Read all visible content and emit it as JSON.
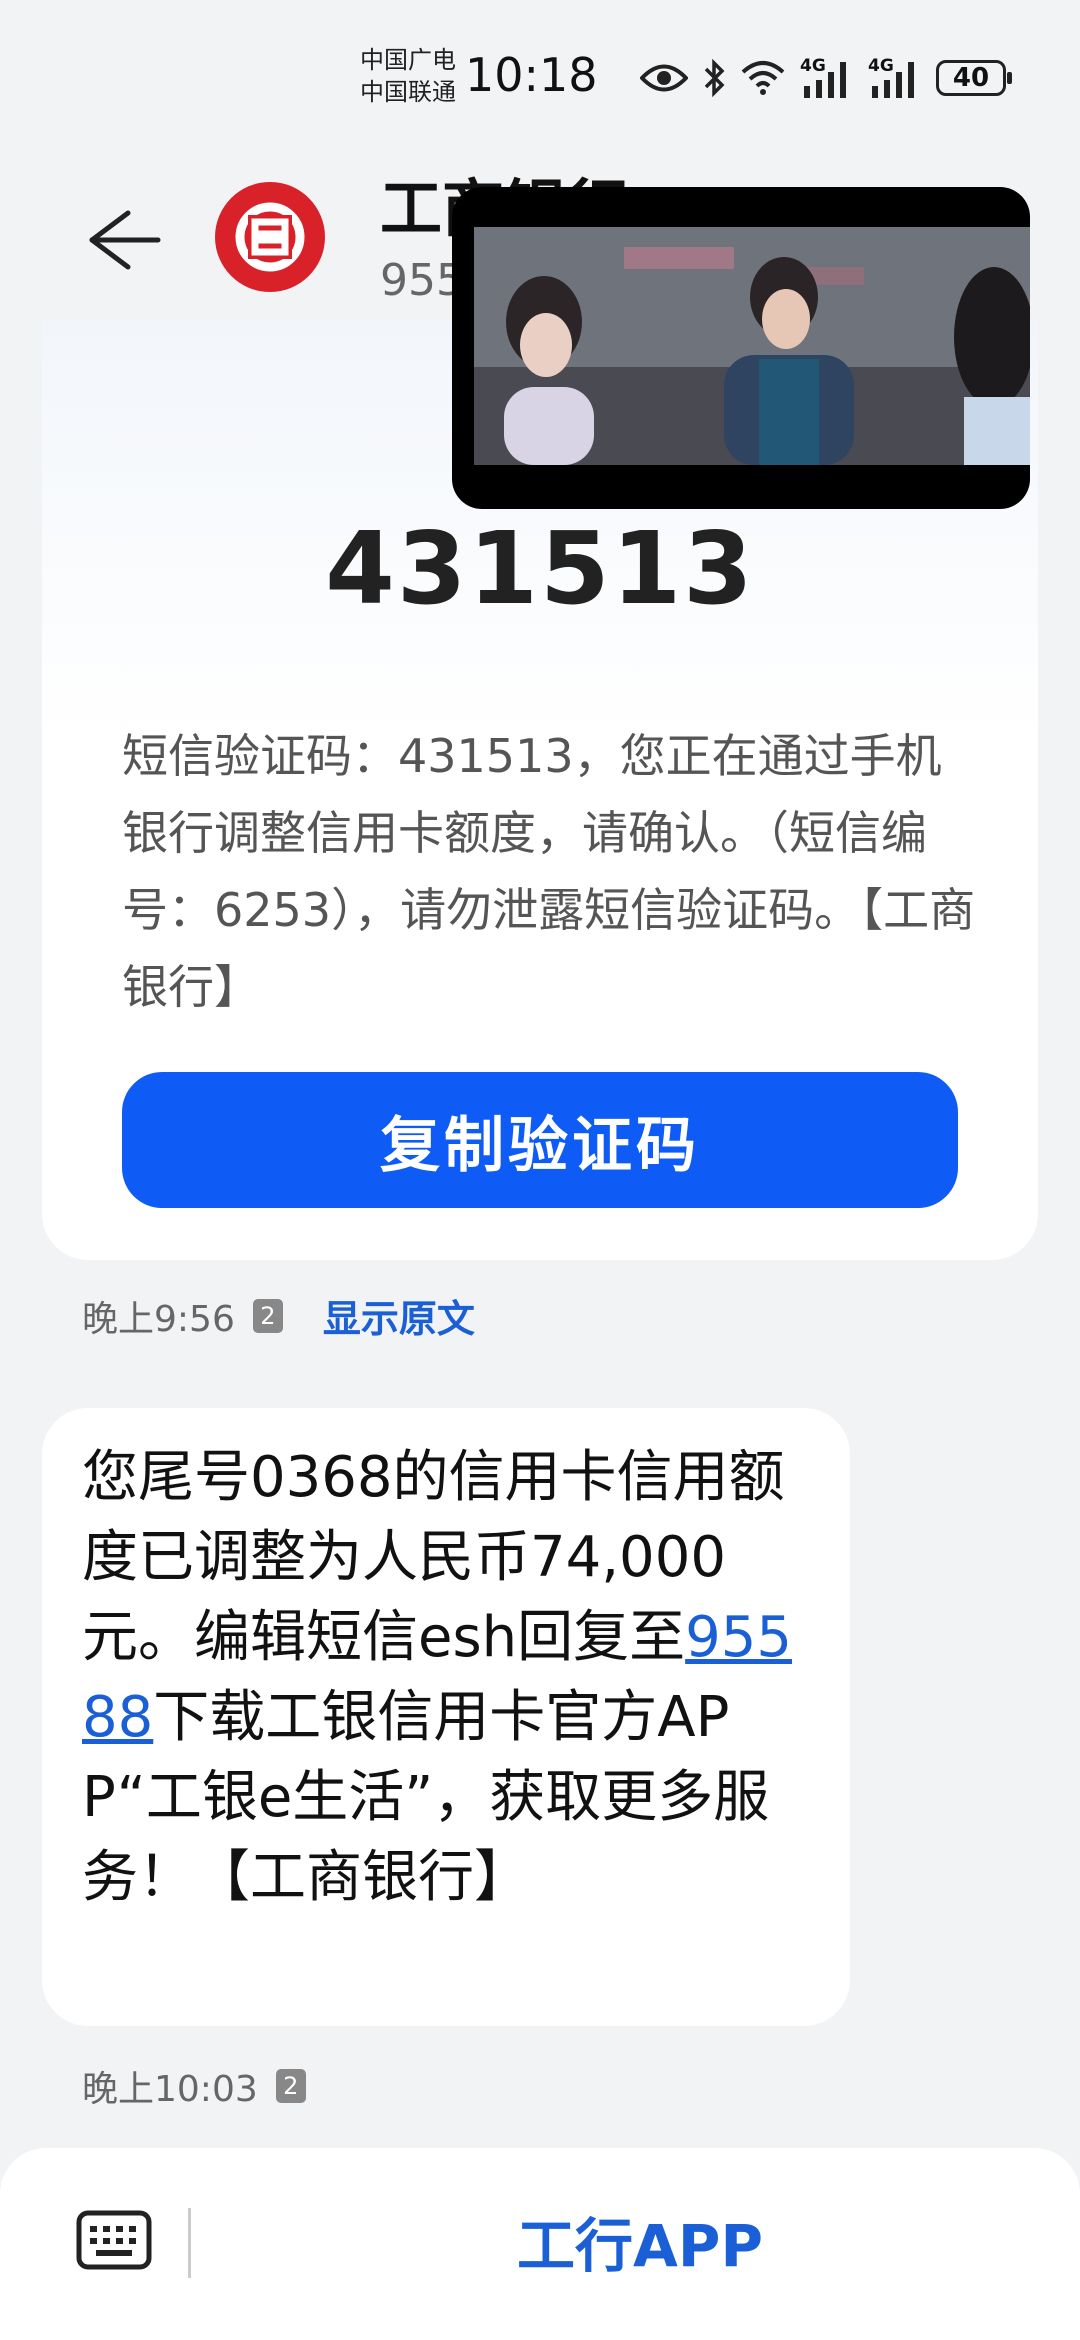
{
  "status_bar": {
    "carrier_1": "中国广电",
    "carrier_2": "中国联通",
    "time": "10:18",
    "network_1": "4G",
    "network_2": "4G",
    "battery": "40"
  },
  "header": {
    "contact_name": "工商银行",
    "contact_number": "955",
    "avatar_color": "#d9212a"
  },
  "code_card": {
    "code": "431513",
    "sms_text": "短信验证码：431513，您正在通过手机银行调整信用卡额度，请确认。（短信编号：6253），请勿泄露短信验证码。【工商银行】",
    "copy_button_label": "复制验证码",
    "accent_color": "#0e5cf5"
  },
  "meta_1": {
    "time": "晚上9:56",
    "sim": "2",
    "show_original": "显示原文"
  },
  "message": {
    "text_before_link": "您尾号0368的信用卡信用额度已调整为人民币74,000元。编辑短信esh回复至",
    "link": "95588",
    "text_after_link": "下载工银信用卡官方APP“工银e生活”，获取更多服务！【工商银行】"
  },
  "meta_2": {
    "time": "晚上10:03",
    "sim": "2"
  },
  "bottom_bar": {
    "app_button_label": "工行APP"
  }
}
